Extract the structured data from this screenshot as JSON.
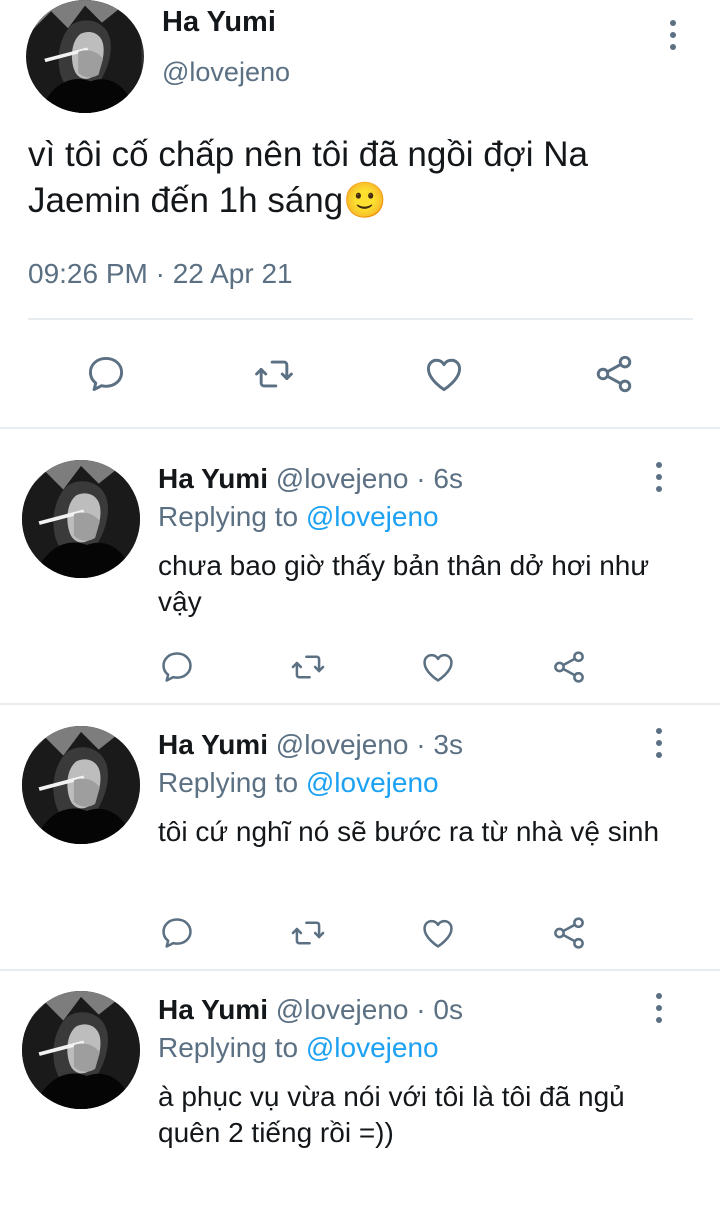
{
  "main_tweet": {
    "name": "Ha Yumi",
    "handle": "@lovejeno",
    "text": "vì tôi cố chấp nên tôi đã ngồi đợi Na Jaemin đến 1h sáng🙂",
    "timestamp": "09:26 PM · 22 Apr 21",
    "actions": [
      "reply-icon",
      "retweet-icon",
      "like-icon",
      "share-icon"
    ]
  },
  "replies": [
    {
      "name": "Ha Yumi",
      "handle": "@lovejeno",
      "dot": "·",
      "time": "6s",
      "replying_prefix": "Replying to ",
      "replying_to": "@lovejeno",
      "text": "chưa bao giờ thấy bản thân dở hơi như vậy"
    },
    {
      "name": "Ha Yumi",
      "handle": "@lovejeno",
      "dot": "·",
      "time": "3s",
      "replying_prefix": "Replying to ",
      "replying_to": "@lovejeno",
      "text": "tôi cứ nghĩ nó sẽ bước ra từ nhà vệ sinh"
    },
    {
      "name": "Ha Yumi",
      "handle": "@lovejeno",
      "dot": "·",
      "time": "0s",
      "replying_prefix": "Replying to ",
      "replying_to": "@lovejeno",
      "text": "à phục vụ vừa nói với tôi là tôi đã ngủ quên 2 tiếng rồi =))"
    }
  ],
  "colors": {
    "text": "#14171a",
    "secondary": "#5b7083",
    "link": "#1da1f2",
    "divider": "#e6ecf0"
  }
}
